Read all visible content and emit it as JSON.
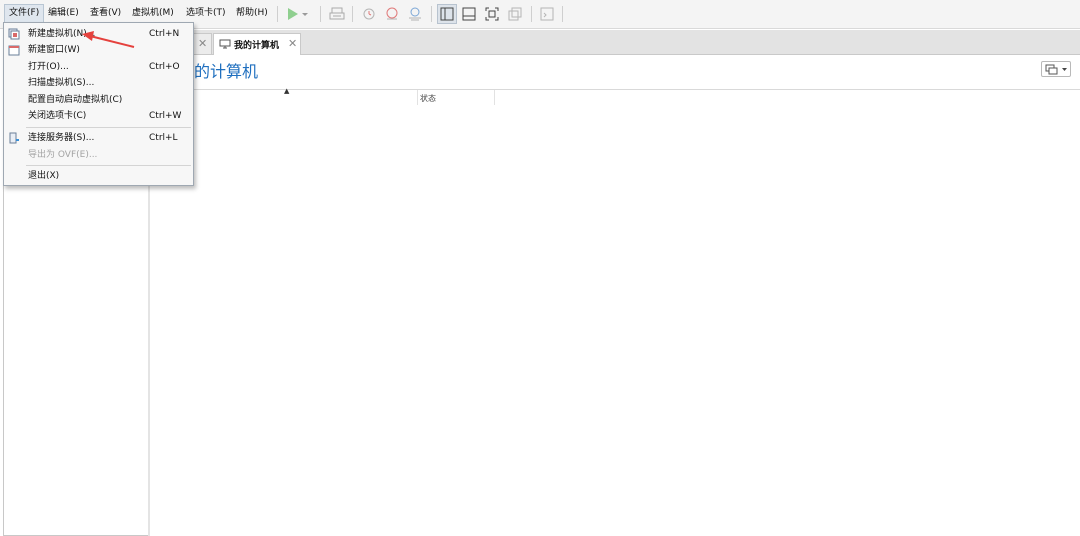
{
  "menubar": {
    "items": [
      {
        "label": "文件(F)"
      },
      {
        "label": "编辑(E)"
      },
      {
        "label": "查看(V)"
      },
      {
        "label": "虚拟机(M)"
      },
      {
        "label": "选项卡(T)"
      },
      {
        "label": "帮助(H)"
      }
    ]
  },
  "toolbar": {
    "icons": [
      "play-icon",
      "dropdown-arrow-icon",
      "send-keys-icon",
      "snapshot-icon",
      "revert-snapshot-icon",
      "snapshot-manager-icon",
      "library-view-icon",
      "thumbnail-bar-icon",
      "fullscreen-icon",
      "unity-icon",
      "console-icon"
    ]
  },
  "tabs": [
    {
      "label": ""
    },
    {
      "label": "我的计算机"
    }
  ],
  "main": {
    "title": "的计算机",
    "columns": {
      "status": "状态"
    }
  },
  "file_menu": {
    "items": [
      {
        "label": "新建虚拟机(N)...",
        "shortcut": "Ctrl+N",
        "icon": "new-vm-icon"
      },
      {
        "label": "新建窗口(W)",
        "shortcut": "",
        "icon": "new-window-icon"
      },
      {
        "label": "打开(O)...",
        "shortcut": "Ctrl+O",
        "icon": ""
      },
      {
        "label": "扫描虚拟机(S)...",
        "shortcut": "",
        "icon": ""
      },
      {
        "label": "配置自动启动虚拟机(C)",
        "shortcut": "",
        "icon": ""
      },
      {
        "label": "关闭选项卡(C)",
        "shortcut": "Ctrl+W",
        "icon": ""
      },
      {
        "label": "连接服务器(S)...",
        "shortcut": "Ctrl+L",
        "icon": "connect-server-icon"
      },
      {
        "label": "导出为 OVF(E)...",
        "shortcut": "",
        "icon": "",
        "disabled": true
      },
      {
        "label": "退出(X)",
        "shortcut": "",
        "icon": ""
      }
    ]
  },
  "colors": {
    "accent": "#1f6fbf",
    "play": "#3fae3f",
    "annotation_arrow": "#e5413d"
  }
}
